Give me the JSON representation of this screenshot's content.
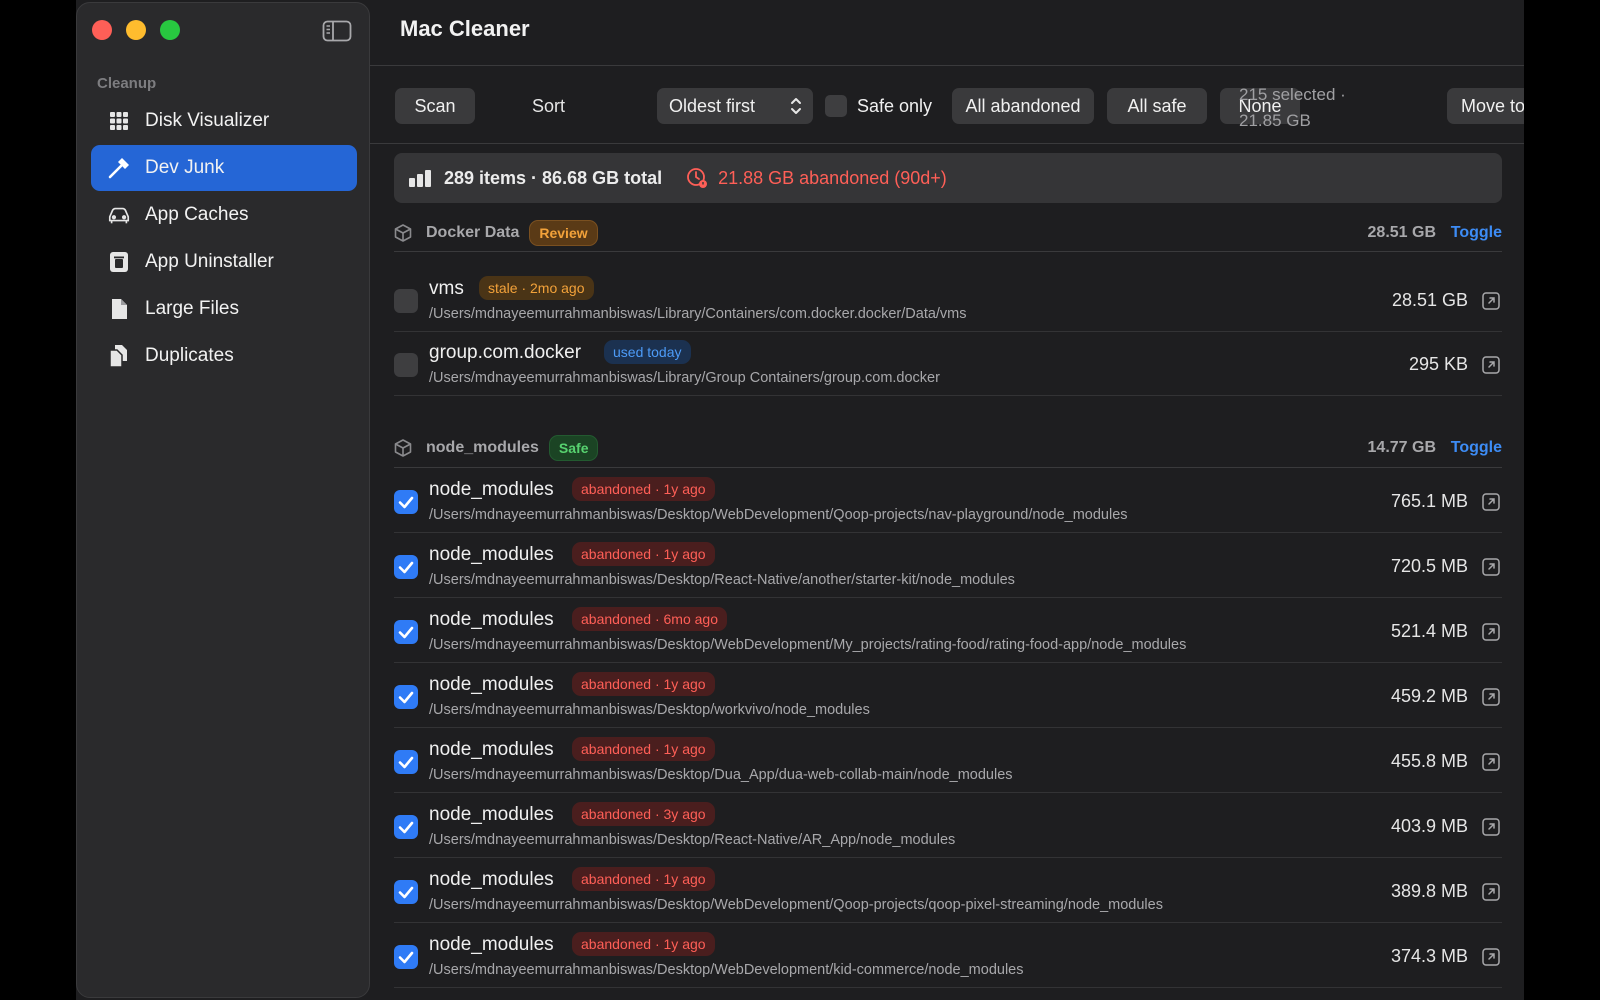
{
  "colors": {
    "accent": "#2566d6",
    "checkbox": "#2f7bf6",
    "danger": "#ff5f57",
    "warning": "#f3a23a",
    "success": "#57d26f",
    "link": "#3d8cf5"
  },
  "sidebar": {
    "section": "Cleanup",
    "items": [
      {
        "label": "Disk Visualizer",
        "icon": "grid-icon",
        "active": false
      },
      {
        "label": "Dev Junk",
        "icon": "hammer-icon",
        "active": true
      },
      {
        "label": "App Caches",
        "icon": "car-icon",
        "active": false
      },
      {
        "label": "App Uninstaller",
        "icon": "trash-app-icon",
        "active": false
      },
      {
        "label": "Large Files",
        "icon": "document-icon",
        "active": false
      },
      {
        "label": "Duplicates",
        "icon": "documents-icon",
        "active": false
      }
    ]
  },
  "header": {
    "title": "Mac Cleaner"
  },
  "toolbar": {
    "scan": "Scan",
    "sort_label": "Sort",
    "sort_value": "Oldest first",
    "safe_only": "Safe only",
    "all_abandoned": "All abandoned",
    "all_safe": "All safe",
    "none": "None",
    "selected_line1": "215 selected ·",
    "selected_line2": "21.85 GB",
    "move_to_trash": "Move to Trash"
  },
  "summary": {
    "total": "289 items · 86.68 GB total",
    "abandoned": "21.88 GB abandoned (90d+)"
  },
  "groups": [
    {
      "name": "Docker Data",
      "badge": "Review",
      "size": "28.51 GB",
      "toggle": "Toggle",
      "items": [
        {
          "name": "vms",
          "badge": "stale · 2mo ago",
          "path": "/Users/mdnayeemurrahmanbiswas/Library/Containers/com.docker.docker/Data/vms",
          "size": "28.51 GB",
          "checked": false
        },
        {
          "name": "group.com.docker",
          "badge": "used today",
          "path": "/Users/mdnayeemurrahmanbiswas/Library/Group Containers/group.com.docker",
          "size": "295 KB",
          "checked": false
        }
      ]
    },
    {
      "name": "node_modules",
      "badge": "Safe",
      "size": "14.77 GB",
      "toggle": "Toggle",
      "items": [
        {
          "name": "node_modules",
          "badge": "abandoned · 1y ago",
          "path": "/Users/mdnayeemurrahmanbiswas/Desktop/WebDevelopment/Qoop-projects/nav-playground/node_modules",
          "size": "765.1 MB",
          "checked": true
        },
        {
          "name": "node_modules",
          "badge": "abandoned · 1y ago",
          "path": "/Users/mdnayeemurrahmanbiswas/Desktop/React-Native/another/starter-kit/node_modules",
          "size": "720.5 MB",
          "checked": true
        },
        {
          "name": "node_modules",
          "badge": "abandoned · 6mo ago",
          "path": "/Users/mdnayeemurrahmanbiswas/Desktop/WebDevelopment/My_projects/rating-food/rating-food-app/node_modules",
          "size": "521.4 MB",
          "checked": true
        },
        {
          "name": "node_modules",
          "badge": "abandoned · 1y ago",
          "path": "/Users/mdnayeemurrahmanbiswas/Desktop/workvivo/node_modules",
          "size": "459.2 MB",
          "checked": true
        },
        {
          "name": "node_modules",
          "badge": "abandoned · 1y ago",
          "path": "/Users/mdnayeemurrahmanbiswas/Desktop/Dua_App/dua-web-collab-main/node_modules",
          "size": "455.8 MB",
          "checked": true
        },
        {
          "name": "node_modules",
          "badge": "abandoned · 3y ago",
          "path": "/Users/mdnayeemurrahmanbiswas/Desktop/React-Native/AR_App/node_modules",
          "size": "403.9 MB",
          "checked": true
        },
        {
          "name": "node_modules",
          "badge": "abandoned · 1y ago",
          "path": "/Users/mdnayeemurrahmanbiswas/Desktop/WebDevelopment/Qoop-projects/qoop-pixel-streaming/node_modules",
          "size": "389.8 MB",
          "checked": true
        },
        {
          "name": "node_modules",
          "badge": "abandoned · 1y ago",
          "path": "/Users/mdnayeemurrahmanbiswas/Desktop/WebDevelopment/kid-commerce/node_modules",
          "size": "374.3 MB",
          "checked": true
        }
      ]
    }
  ]
}
